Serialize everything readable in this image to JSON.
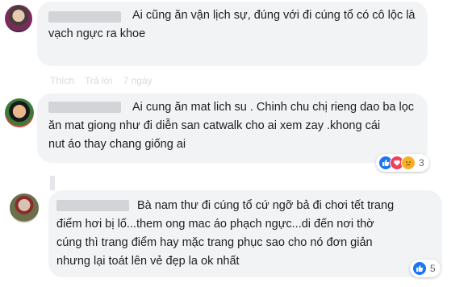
{
  "comments": [
    {
      "text": "Ai cũng ăn vận lịch sự, đúng với đi cúng tổ có cô lộc là\nvạch ngực ra khoe",
      "meta": [
        "Thích",
        "Trả lời",
        "7 ngày"
      ],
      "reactions": null
    },
    {
      "text": "Ai cung ăn mat lich su . Chinh chu chị rieng dao ba lọc\năn mat giong như đi diễn san catwalk cho ai xem zay .khong cái\nnut áo thay chang giống ai",
      "reactions": {
        "types": [
          "like-icon",
          "love-icon",
          "sad-icon"
        ],
        "count": "3"
      }
    },
    {
      "text": "Bà nam thư đi cúng tổ cứ ngỡ bả đi chơi tết trang\nđiểm hơi bị lố...them ong mac áo phạch ngực...di đến nơi thờ\ncúng thì trang điểm hay mặc trang phục sao cho nó đơn giản\nnhưng lại toát lên vẻ đẹp la ok nhất",
      "reactions": {
        "types": [
          "like-icon"
        ],
        "count": "5"
      }
    }
  ],
  "colors": {
    "bubble": "#f2f3f5",
    "like": "#1877f2",
    "love": "#f33e58",
    "sad": "#f7b125"
  }
}
